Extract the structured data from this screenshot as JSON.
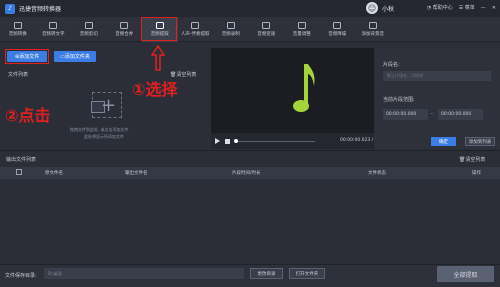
{
  "app": {
    "title": "迅捷音频转换器",
    "logo_icon": "music-logo-icon"
  },
  "user": {
    "avatar_text": "口",
    "name": "小秋"
  },
  "titlebar": {
    "help": "帮助中心",
    "menu": "菜单"
  },
  "toolbar": {
    "items": [
      {
        "label": "音频转换",
        "icon": "convert-icon"
      },
      {
        "label": "音频转文字",
        "icon": "text-icon"
      },
      {
        "label": "音频剪切",
        "icon": "scissors-icon"
      },
      {
        "label": "音频合并",
        "icon": "merge-icon"
      },
      {
        "label": "音频提取",
        "icon": "extract-icon"
      },
      {
        "label": "人声-伴奏提取",
        "icon": "voice-icon"
      },
      {
        "label": "音频录制",
        "icon": "mic-icon"
      },
      {
        "label": "音频变速",
        "icon": "speed-icon"
      },
      {
        "label": "音量调整",
        "icon": "volume-icon"
      },
      {
        "label": "音频降噪",
        "icon": "denoise-icon"
      },
      {
        "label": "添加背景音",
        "icon": "bgm-icon"
      }
    ],
    "active_index": 4
  },
  "left": {
    "add_file": "添加文件",
    "add_folder": "添加文件夹",
    "list_label": "文件列表",
    "clear_list": "清空列表",
    "hint_line1": "拖拽文件到此处, 或点击添加文件",
    "hint_line2": "此处将显示所添加文件"
  },
  "annotations": {
    "select": "①选择",
    "click": "②点击"
  },
  "player": {
    "time": "00:00:00.023 / 00:00:00.000"
  },
  "right": {
    "segment_label": "片段名:",
    "segment_placeholder": "默认片段名，可修改",
    "range_label": "当前片段范围:",
    "start_time": "00:00:00.000",
    "end_time": "00:00:00.000",
    "confirm": "确定",
    "add_to_list": "添加到列表"
  },
  "output": {
    "title": "输出文件列表",
    "clear": "清空列表",
    "columns": [
      "原文件名",
      "输出文件名",
      "片段时间/时长",
      "文件状态",
      "操作"
    ]
  },
  "bottom": {
    "save_label": "文件保存目录:",
    "save_path": "D:\\桌面",
    "change_dir": "更改目录",
    "open_folder": "打开文件夹",
    "extract_all": "全部提取"
  }
}
